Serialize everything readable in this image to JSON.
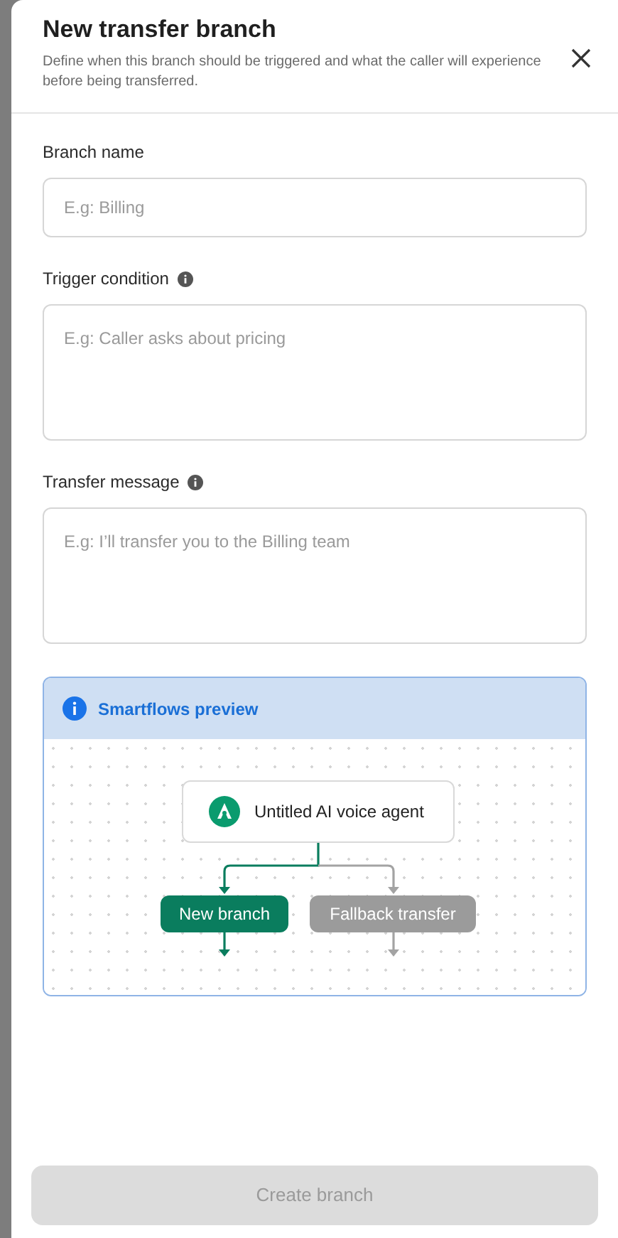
{
  "panel": {
    "title": "New transfer branch",
    "subtitle": "Define when this branch should be triggered and what the caller will experience before being transferred."
  },
  "fields": [
    {
      "label": "Branch name",
      "kind": "input",
      "info": false,
      "placeholder": "E.g: Billing"
    },
    {
      "label": "Trigger condition",
      "kind": "textarea",
      "info": true,
      "placeholder": "E.g: Caller asks about pricing"
    },
    {
      "label": "Transfer message",
      "kind": "textarea",
      "info": true,
      "placeholder": "E.g: I’ll transfer you to the Billing team"
    }
  ],
  "preview": {
    "title": "Smartflows preview",
    "agent": "Untitled AI voice agent",
    "branches": [
      {
        "label": "New branch",
        "kind": "new"
      },
      {
        "label": "Fallback transfer",
        "kind": "fallback"
      }
    ]
  },
  "submit": {
    "label": "Create branch",
    "disabled": true
  }
}
